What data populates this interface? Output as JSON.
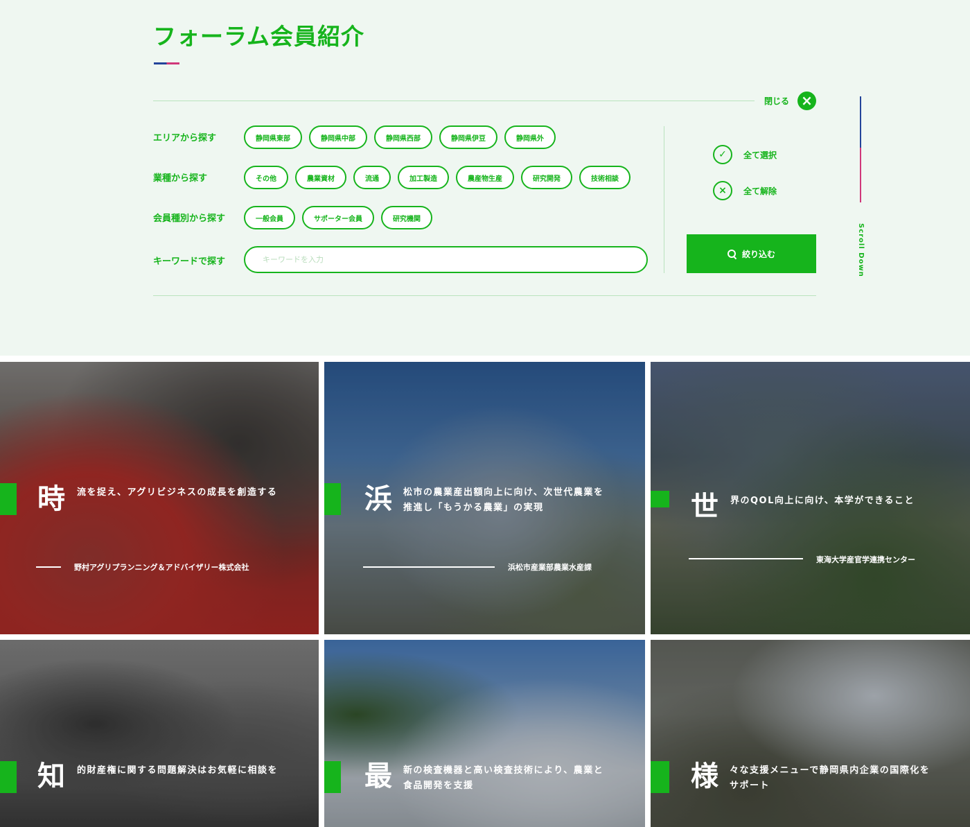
{
  "page": {
    "title": "フォーラム会員紹介",
    "close_label": "閉じる",
    "close_icon": "×",
    "scroll_label": "Scroll Down"
  },
  "filters": {
    "area": {
      "label": "エリアから探す",
      "options": [
        "静岡県東部",
        "静岡県中部",
        "静岡県西部",
        "静岡県伊豆",
        "静岡県外"
      ]
    },
    "industry": {
      "label": "業種から探す",
      "options": [
        "その他",
        "農業資材",
        "流通",
        "加工製造",
        "農産物生産",
        "研究開発",
        "技術相談"
      ]
    },
    "member_type": {
      "label": "会員種別から探す",
      "options": [
        "一般会員",
        "サポーター会員",
        "研究機関"
      ]
    },
    "keyword": {
      "label": "キーワードで探す",
      "placeholder": "キーワードを入力"
    }
  },
  "actions": {
    "select_all": "全て選択",
    "select_all_icon": "✓",
    "clear_all": "全て解除",
    "clear_all_icon": "×",
    "submit": "絞り込む"
  },
  "colors": {
    "accent": "#16b41c",
    "background": "#eff7f1",
    "blue": "#23449a",
    "pink": "#d0387a"
  },
  "cards": [
    {
      "kanji": "時",
      "catch": "流を捉え、アグリビジネスの成長を創造する",
      "org": "野村アグリプランニング＆アドバイザリー株式会社"
    },
    {
      "kanji": "浜",
      "catch": "松市の農業産出額向上に向け、次世代農業を推進し「もうかる農業」の実現",
      "org": "浜松市産業部農業水産課"
    },
    {
      "kanji": "世",
      "catch": "界のQOL向上に向け、本学ができること",
      "org": "東海大学産官学連携センター"
    },
    {
      "kanji": "知",
      "catch": "的財産権に関する問題解決はお気軽に相談を",
      "org": ""
    },
    {
      "kanji": "最",
      "catch": "新の検査機器と高い検査技術により、農業と食品開発を支援",
      "org": ""
    },
    {
      "kanji": "様",
      "catch": "々な支援メニューで静岡県内企業の国際化をサポート",
      "org": ""
    }
  ]
}
